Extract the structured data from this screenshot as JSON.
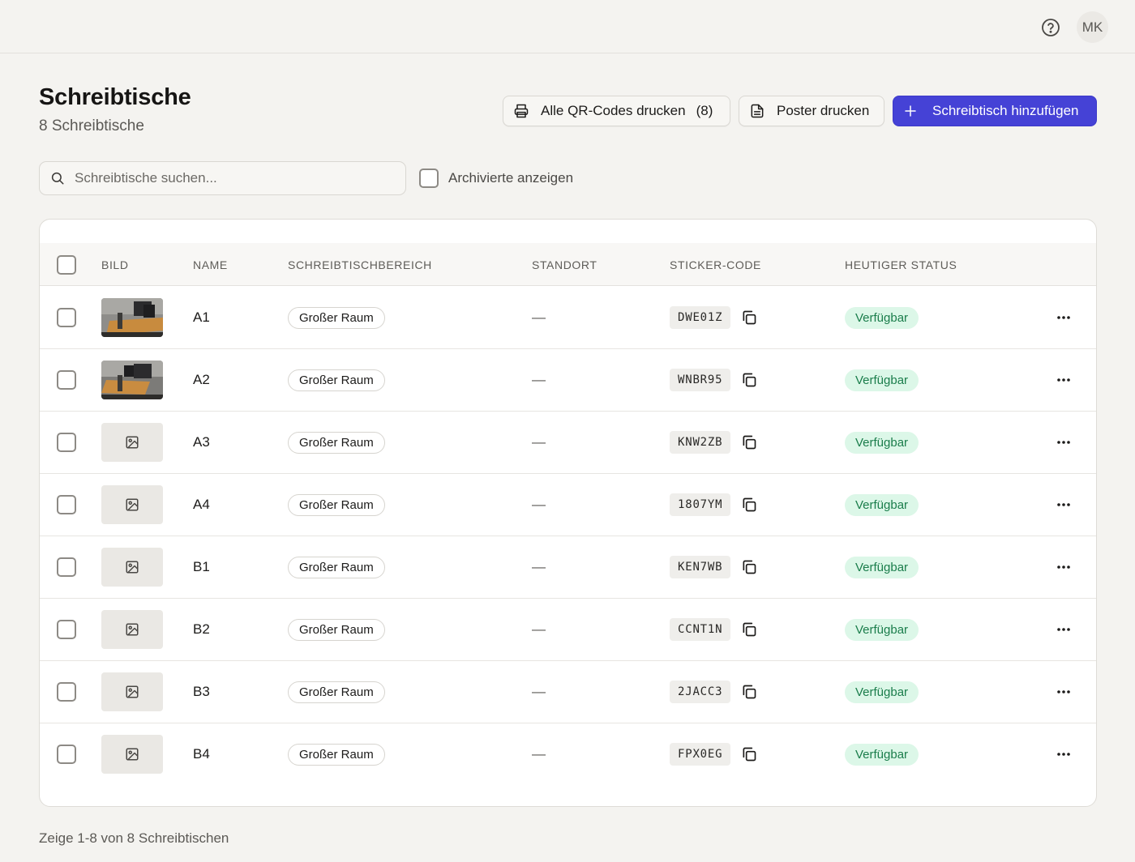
{
  "header": {
    "user_initials": "MK"
  },
  "page": {
    "title": "Schreibtische",
    "subtitle": "8 Schreibtische"
  },
  "actions": {
    "print_qr_label": "Alle QR-Codes drucken",
    "print_qr_count": "(8)",
    "print_poster_label": "Poster drucken",
    "add_desk_label": "Schreibtisch hinzufügen"
  },
  "filters": {
    "search_placeholder": "Schreibtische suchen...",
    "search_value": "",
    "show_archived_label": "Archivierte anzeigen",
    "show_archived_checked": false
  },
  "table": {
    "columns": [
      "BILD",
      "NAME",
      "SCHREIBTISCHBEREICH",
      "STANDORT",
      "STICKER-CODE",
      "HEUTIGER STATUS"
    ],
    "rows": [
      {
        "name": "A1",
        "area": "Großer Raum",
        "location": "—",
        "code": "DWE01Z",
        "status": "Verfügbar",
        "image": "photo"
      },
      {
        "name": "A2",
        "area": "Großer Raum",
        "location": "—",
        "code": "WNBR95",
        "status": "Verfügbar",
        "image": "photo"
      },
      {
        "name": "A3",
        "area": "Großer Raum",
        "location": "—",
        "code": "KNW2ZB",
        "status": "Verfügbar",
        "image": "placeholder"
      },
      {
        "name": "A4",
        "area": "Großer Raum",
        "location": "—",
        "code": "1807YM",
        "status": "Verfügbar",
        "image": "placeholder"
      },
      {
        "name": "B1",
        "area": "Großer Raum",
        "location": "—",
        "code": "KEN7WB",
        "status": "Verfügbar",
        "image": "placeholder"
      },
      {
        "name": "B2",
        "area": "Großer Raum",
        "location": "—",
        "code": "CCNT1N",
        "status": "Verfügbar",
        "image": "placeholder"
      },
      {
        "name": "B3",
        "area": "Großer Raum",
        "location": "—",
        "code": "2JACC3",
        "status": "Verfügbar",
        "image": "placeholder"
      },
      {
        "name": "B4",
        "area": "Großer Raum",
        "location": "—",
        "code": "FPX0EG",
        "status": "Verfügbar",
        "image": "placeholder"
      }
    ]
  },
  "footer": {
    "pagination_text": "Zeige 1-8 von 8 Schreibtischen"
  },
  "colors": {
    "primary": "#4542d6",
    "status_available_bg": "#dcf7e8",
    "status_available_text": "#1a7d4b",
    "background": "#f4f3f0"
  },
  "icons": {
    "help": "help-circle-icon",
    "print": "printer-icon",
    "poster": "document-icon",
    "add": "plus-icon",
    "search": "search-icon",
    "copy": "copy-icon",
    "more": "more-horizontal-icon",
    "image_placeholder": "image-icon"
  }
}
